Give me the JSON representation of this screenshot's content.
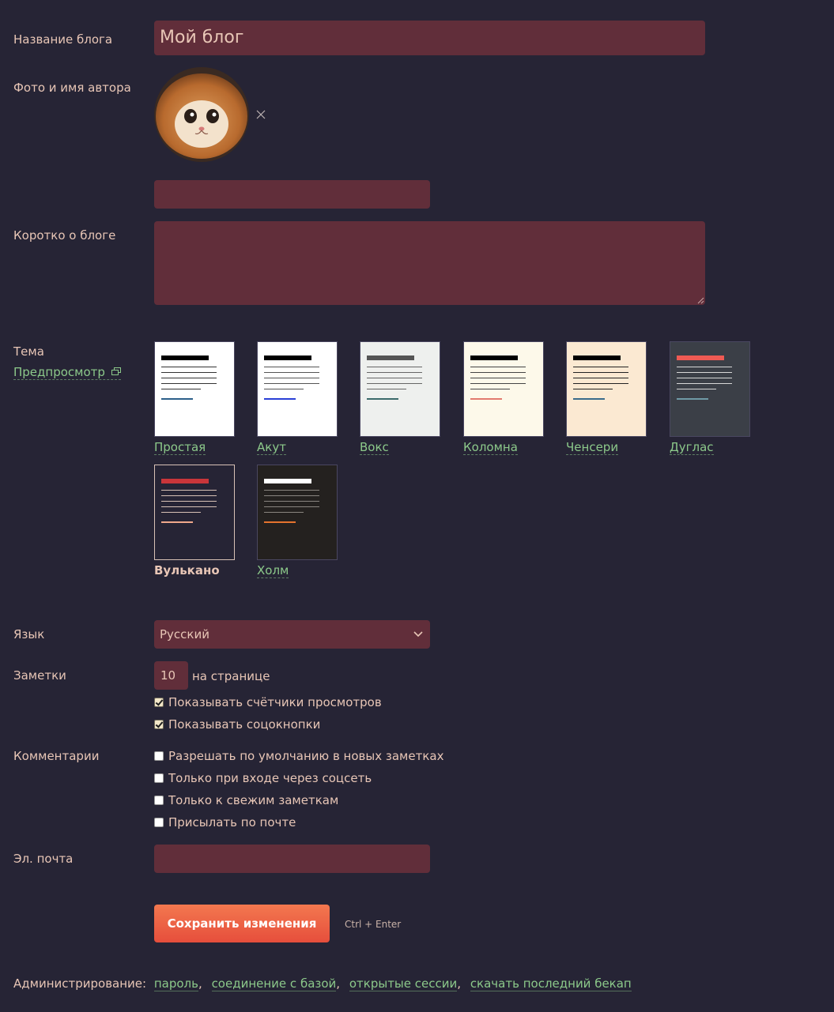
{
  "labels": {
    "blog_title": "Название блога",
    "author": "Фото и имя автора",
    "about": "Коротко о блоге",
    "theme": "Тема",
    "preview": "Предпросмотр",
    "language": "Язык",
    "notes": "Заметки",
    "comments": "Комментарии",
    "email": "Эл. почта"
  },
  "blog_title_value": "Мой блог",
  "author_name_value": "",
  "about_value": "",
  "themes": [
    {
      "name": "Простая",
      "selected": false
    },
    {
      "name": "Акут",
      "selected": false
    },
    {
      "name": "Вокс",
      "selected": false
    },
    {
      "name": "Коломна",
      "selected": false
    },
    {
      "name": "Ченсери",
      "selected": false
    },
    {
      "name": "Дуглас",
      "selected": false
    },
    {
      "name": "Вулькано",
      "selected": true
    },
    {
      "name": "Холм",
      "selected": false
    }
  ],
  "language_value": "Русский",
  "notes_per_page": "10",
  "notes_per_page_suffix": "на странице",
  "notes_options": [
    {
      "label": "Показывать счётчики просмотров",
      "checked": true
    },
    {
      "label": "Показывать соцокнопки",
      "checked": true
    }
  ],
  "comments_options": [
    {
      "label": "Разрешать по умолчанию в новых заметках",
      "checked": false
    },
    {
      "label": "Только при входе через соцсеть",
      "checked": false
    },
    {
      "label": "Только к свежим заметкам",
      "checked": false
    },
    {
      "label": "Присылать по почте",
      "checked": false
    }
  ],
  "email_value": "",
  "save_label": "Сохранить изменения",
  "save_hint": "Ctrl + Enter",
  "admin": {
    "label": "Администрирование:",
    "links": [
      "пароль",
      "соединение с базой",
      "открытые сессии",
      "скачать последний бекап"
    ]
  },
  "colors": {
    "background": "#262435",
    "field": "#612e3a",
    "link": "#8cc98a",
    "text": "#e8c6b6",
    "button": "#ea5a40"
  }
}
